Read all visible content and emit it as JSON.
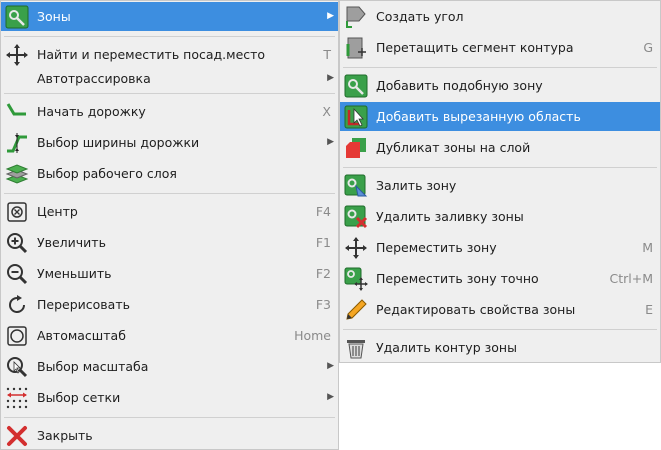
{
  "main_menu": {
    "items": [
      {
        "label": "Зоны",
        "shortcut": "",
        "submenu": true,
        "icon": "zone-icon"
      },
      {
        "label": "Найти и переместить посад.место",
        "shortcut": "T",
        "submenu": false,
        "icon": "move-cross-icon"
      },
      {
        "label": "Автотрассировка",
        "shortcut": "",
        "submenu": true,
        "icon": ""
      },
      {
        "label": "Начать дорожку",
        "shortcut": "X",
        "submenu": false,
        "icon": "track-icon"
      },
      {
        "label": "Выбор ширины дорожки",
        "shortcut": "",
        "submenu": true,
        "icon": "track-width-icon"
      },
      {
        "label": "Выбор рабочего слоя",
        "shortcut": "",
        "submenu": false,
        "icon": "layers-icon"
      },
      {
        "label": "Центр",
        "shortcut": "F4",
        "submenu": false,
        "icon": "center-icon"
      },
      {
        "label": "Увеличить",
        "shortcut": "F1",
        "submenu": false,
        "icon": "zoom-in-icon"
      },
      {
        "label": "Уменьшить",
        "shortcut": "F2",
        "submenu": false,
        "icon": "zoom-out-icon"
      },
      {
        "label": "Перерисовать",
        "shortcut": "F3",
        "submenu": false,
        "icon": "redraw-icon"
      },
      {
        "label": "Автомасштаб",
        "shortcut": "Home",
        "submenu": false,
        "icon": "zoom-fit-icon"
      },
      {
        "label": "Выбор масштаба",
        "shortcut": "",
        "submenu": true,
        "icon": "zoom-select-icon"
      },
      {
        "label": "Выбор сетки",
        "shortcut": "",
        "submenu": true,
        "icon": "grid-icon"
      },
      {
        "label": "Закрыть",
        "shortcut": "",
        "submenu": false,
        "icon": "close-icon"
      }
    ]
  },
  "sub_menu": {
    "items": [
      {
        "label": "Создать угол",
        "shortcut": "",
        "icon": "create-corner-icon"
      },
      {
        "label": "Перетащить сегмент контура",
        "shortcut": "G",
        "icon": "drag-segment-icon"
      },
      {
        "label": "Добавить подобную зону",
        "shortcut": "",
        "icon": "add-similar-zone-icon"
      },
      {
        "label": "Добавить вырезанную область",
        "shortcut": "",
        "icon": "add-cutout-icon",
        "highlighted": true
      },
      {
        "label": "Дубликат зоны на слой",
        "shortcut": "",
        "icon": "duplicate-zone-icon"
      },
      {
        "label": "Залить зону",
        "shortcut": "",
        "icon": "fill-zone-icon"
      },
      {
        "label": "Удалить заливку зоны",
        "shortcut": "",
        "icon": "unfill-zone-icon"
      },
      {
        "label": "Переместить зону",
        "shortcut": "M",
        "icon": "move-zone-icon"
      },
      {
        "label": "Переместить зону точно",
        "shortcut": "Ctrl+M",
        "icon": "move-zone-exact-icon"
      },
      {
        "label": "Редактировать свойства зоны",
        "shortcut": "E",
        "icon": "edit-zone-icon"
      },
      {
        "label": "Удалить контур зоны",
        "shortcut": "",
        "icon": "delete-zone-icon"
      }
    ]
  },
  "colors": {
    "highlight": "#3d8ee0",
    "menu_bg": "#efefef",
    "shortcut": "#8a8a8a"
  }
}
